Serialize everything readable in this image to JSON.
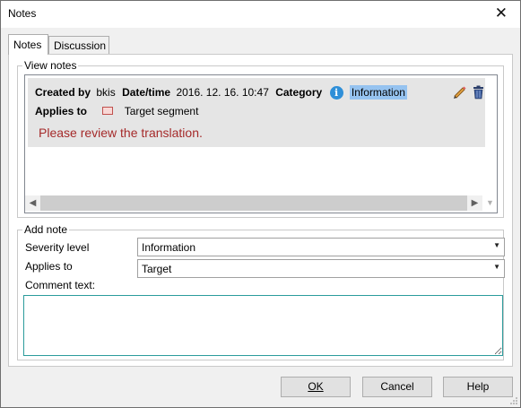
{
  "window": {
    "title": "Notes",
    "close_glyph": "✕"
  },
  "tabs": [
    {
      "label": "Notes",
      "active": true
    },
    {
      "label": "Discussion",
      "active": false
    }
  ],
  "view_notes": {
    "legend": "View notes",
    "note": {
      "created_by_label": "Created by",
      "created_by": "bkis",
      "datetime_label": "Date/time",
      "datetime": "2016. 12. 16. 10:47",
      "category_label": "Category",
      "category_icon": "info-icon",
      "category": "Information",
      "applies_to_label": "Applies to",
      "applies_to": "Target segment",
      "comment": "Please review the translation.",
      "comment_color": "#a52a2a"
    }
  },
  "add_note": {
    "legend": "Add note",
    "severity_label": "Severity level",
    "severity_value": "Information",
    "applies_label": "Applies to",
    "applies_value": "Target",
    "comment_label": "Comment text:",
    "comment_value": ""
  },
  "buttons": {
    "ok": "OK",
    "cancel": "Cancel",
    "help": "Help"
  },
  "colors": {
    "accent_focus": "#2b9c9c",
    "selection": "#96c3f0",
    "info": "#2f8fd8"
  }
}
